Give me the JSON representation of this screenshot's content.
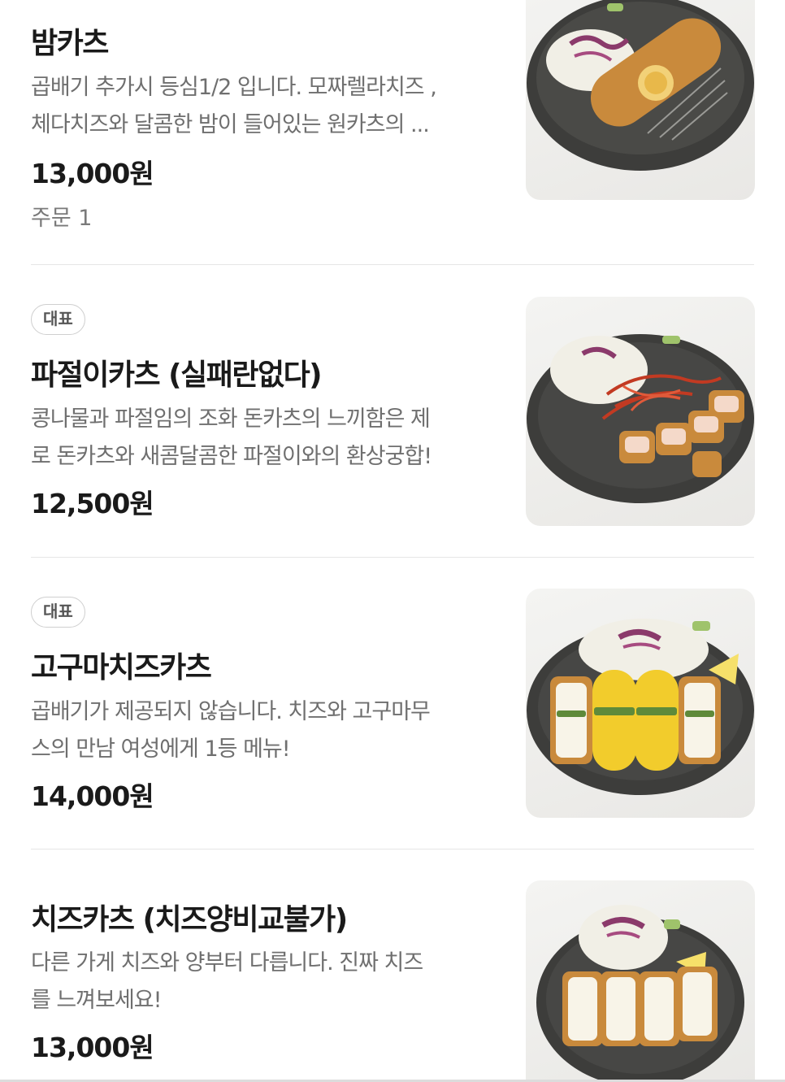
{
  "colors": {
    "text": "#1a1a1a",
    "muted": "#6f6f6f",
    "divider": "#e6e6e6",
    "plate": "#3d3d3b",
    "cutlet": "#c98a3c",
    "cabbage": "#f1efe6",
    "purple_cabbage": "#8b3a6b",
    "cheese": "#f8f4e8",
    "sweet_potato": "#f2cc2c"
  },
  "menu": [
    {
      "badge": "",
      "name": "밤카츠",
      "desc": [
        "곱배기 추가시 등심1/2 입니다. 모짜렐라치즈 ,",
        "체다치즈와 달콤한 밤이 들어있는 원카츠의 ..."
      ],
      "price": "13,000원",
      "orders": "주문 1",
      "photo_icon": "chestnut-katsu-photo"
    },
    {
      "badge": "대표",
      "name": "파절이카츠 (실패란없다)",
      "desc": [
        "콩나물과 파절임의 조화 돈카츠의 느끼함은 제",
        "로 돈카츠와 새콤달콤한 파절이와의 환상궁합!"
      ],
      "price": "12,500원",
      "orders": "",
      "photo_icon": "green-onion-katsu-photo"
    },
    {
      "badge": "대표",
      "name": "고구마치즈카츠",
      "desc": [
        "곱배기가 제공되지 않습니다. 치즈와 고구마무",
        "스의 만남 여성에게 1등 메뉴!"
      ],
      "price": "14,000원",
      "orders": "",
      "photo_icon": "sweet-potato-cheese-katsu-photo"
    },
    {
      "badge": "",
      "name": "치즈카츠 (치즈양비교불가)",
      "desc": [
        "다른 가게 치즈와 양부터 다릅니다. 진짜 치즈",
        "를 느껴보세요!"
      ],
      "price": "13,000원",
      "orders": "",
      "photo_icon": "cheese-katsu-photo"
    }
  ]
}
